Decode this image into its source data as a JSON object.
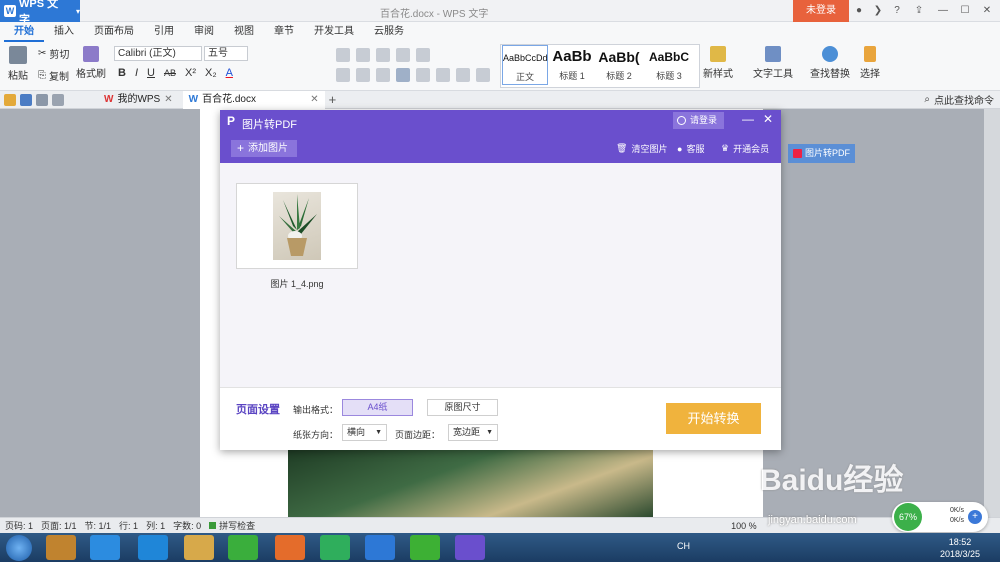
{
  "app": {
    "name": "WPS 文字",
    "logo_letter": "W",
    "doc_title": "百合花.docx - WPS 文字",
    "login": "未登录"
  },
  "ribbon_tabs": [
    "开始",
    "插入",
    "页面布局",
    "引用",
    "审阅",
    "视图",
    "章节",
    "开发工具",
    "云服务"
  ],
  "ribbon": {
    "paste": "粘贴",
    "cut": "剪切",
    "copy": "复制",
    "format_painter": "格式刷",
    "font": "Calibri (正文)",
    "size": "五号",
    "bold": "B",
    "italic": "I",
    "underline": "U",
    "strike": "AB",
    "superscript": "X²",
    "subscript": "X₂",
    "font_color": "A",
    "styles": [
      {
        "sample": "AaBbCcDd",
        "label": "正文"
      },
      {
        "sample": "AaBb",
        "label": "标题 1"
      },
      {
        "sample": "AaBb(",
        "label": "标题 2"
      },
      {
        "sample": "AaBbC",
        "label": "标题 3"
      }
    ],
    "new_style": "新样式",
    "text_tools": "文字工具",
    "find_replace": "查找替换",
    "select": "选择"
  },
  "doc_tabs": {
    "my_wps": "我的WPS",
    "doc": "百合花.docx",
    "search": "点此查找命令"
  },
  "side_button": "图片转PDF",
  "dialog": {
    "title": "图片转PDF",
    "login": "请登录",
    "add": "添加图片",
    "clear": "清空图片",
    "service": "客服",
    "vip": "开通会员",
    "file_name": "图片 1_4.png",
    "page_setup": "页面设置",
    "output_format_label": "输出格式：",
    "format_options": [
      "A4纸",
      "原图尺寸"
    ],
    "orientation_label": "纸张方向：",
    "orientation": "横向",
    "margin_label": "页面边距：",
    "margin": "宽边距",
    "start": "开始转换"
  },
  "status": {
    "page": "页码: 1",
    "pages": "页面: 1/1",
    "section": "节: 1/1",
    "row": "行: 1",
    "col": "列: 1",
    "words": "字数: 0",
    "spell": "拼写检查",
    "zoom": "100 %"
  },
  "network": {
    "percent": "67%",
    "up": "0K/s",
    "down": "0K/s"
  },
  "taskbar": {
    "time": "18:52",
    "date": "2018/3/25",
    "ime": "CH"
  },
  "watermark": {
    "main": "Baidu经验",
    "url": "jingyan.baidu.com"
  },
  "colors": {
    "wps_blue": "#2d78d6",
    "dialog_purple": "#6a4fcd",
    "start_orange": "#f0b33d",
    "login_red": "#e8623c"
  }
}
